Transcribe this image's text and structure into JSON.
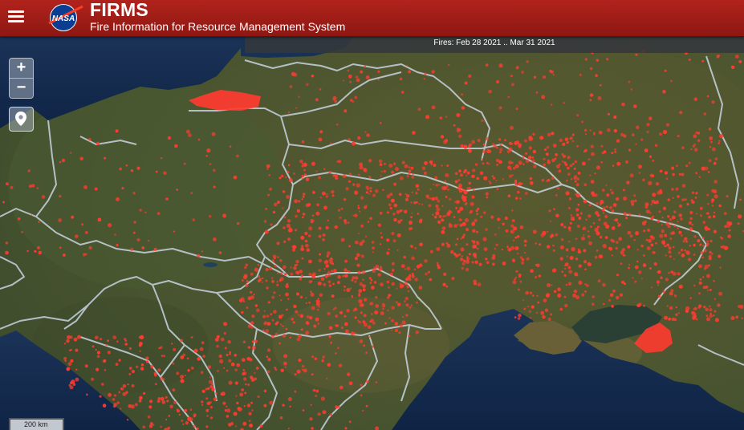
{
  "header": {
    "logo_text": "NASA",
    "title": "FIRMS",
    "subtitle": "Fire Information for Resource Management System"
  },
  "map": {
    "date_range": "Fires: Feb 28 2021 .. Mar 31 2021",
    "scale_label": "200 km",
    "fire_color": "#ff3b30",
    "border_color": "#c7d3e0"
  },
  "controls": {
    "zoom_in": "+",
    "zoom_out": "−"
  }
}
